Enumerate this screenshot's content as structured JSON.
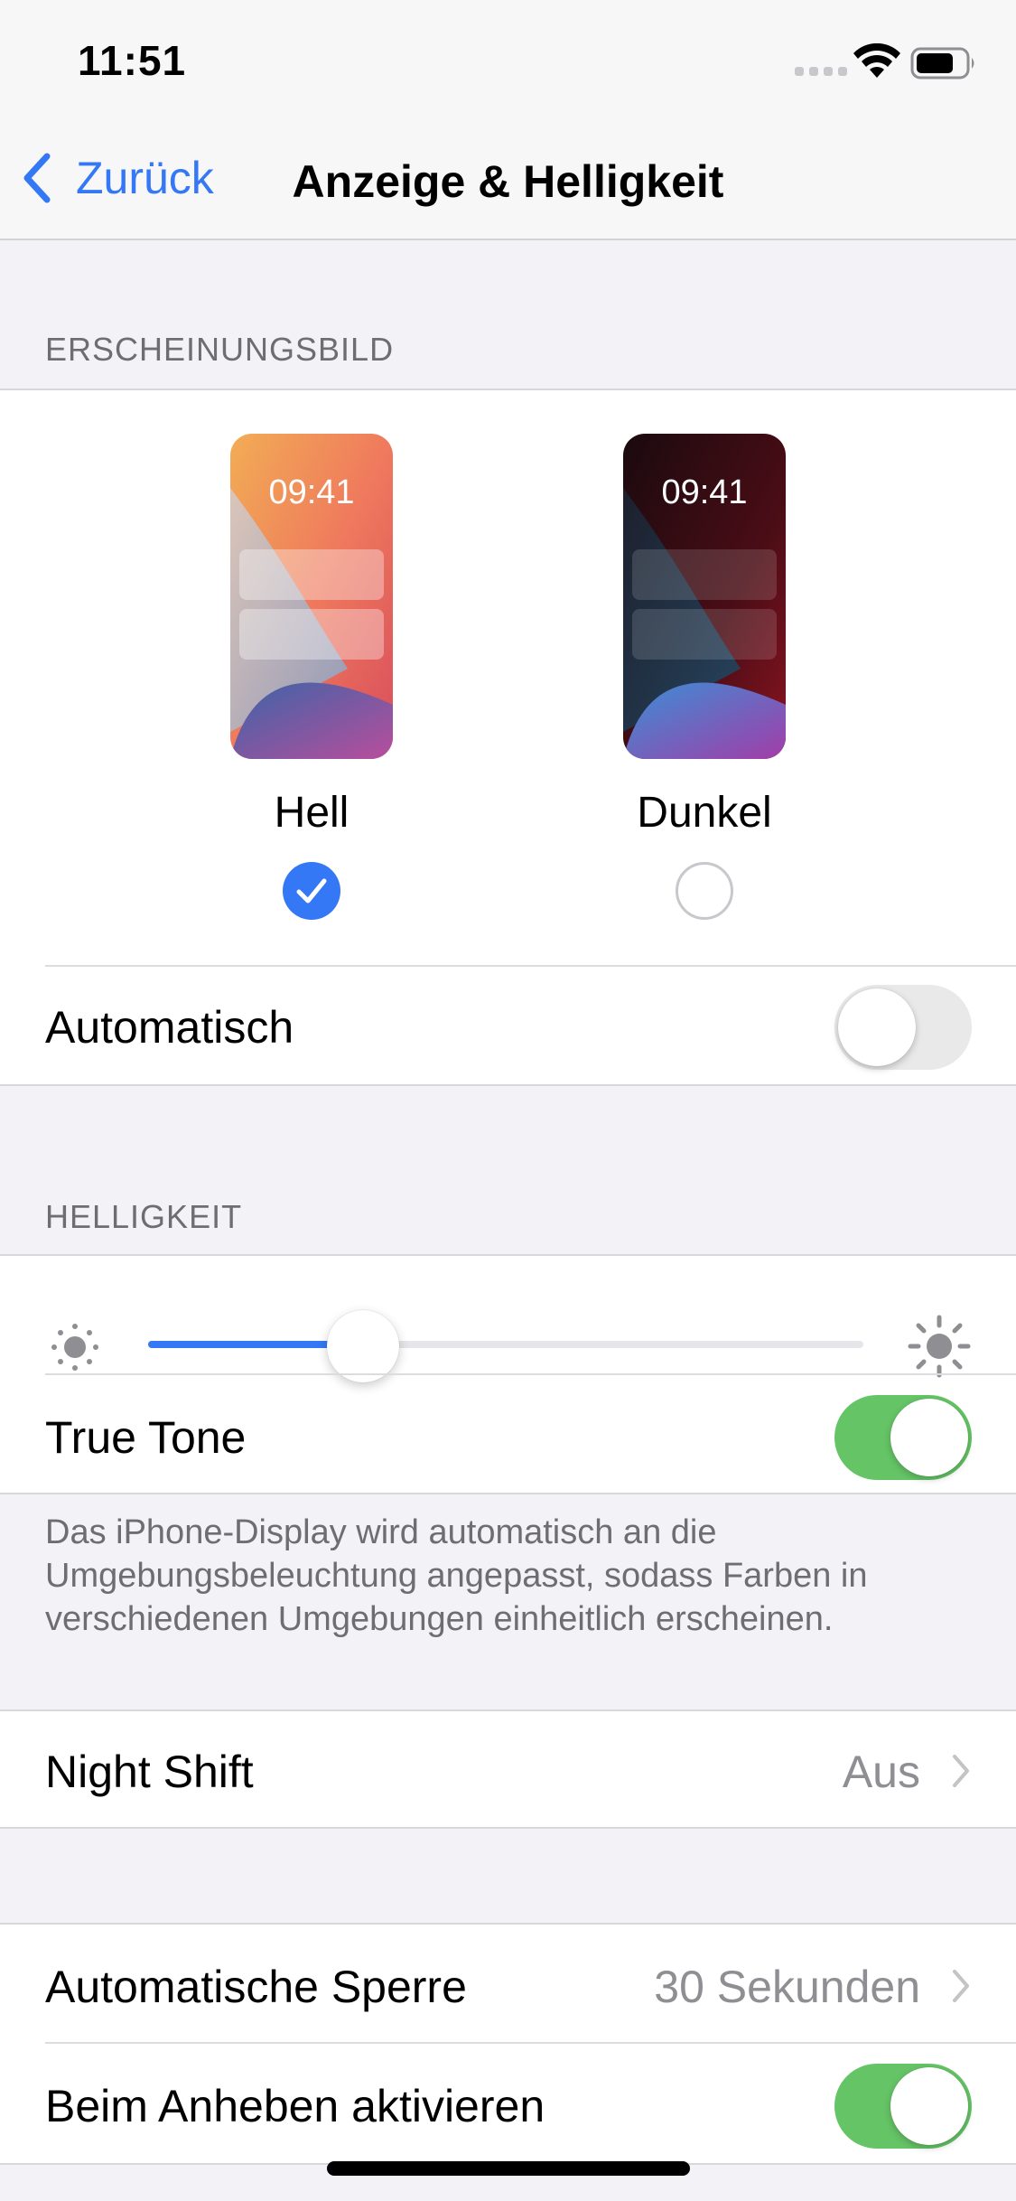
{
  "status_bar": {
    "time": "11:51"
  },
  "nav": {
    "back_label": "Zurück",
    "title": "Anzeige & Helligkeit"
  },
  "appearance": {
    "header": "ERSCHEINUNGSBILD",
    "options": [
      {
        "label": "Hell",
        "preview_time": "09:41",
        "selected": true
      },
      {
        "label": "Dunkel",
        "preview_time": "09:41",
        "selected": false
      }
    ],
    "automatic_label": "Automatisch",
    "automatic_on": false
  },
  "brightness": {
    "header": "HELLIGKEIT",
    "level_percent": 30,
    "true_tone_label": "True Tone",
    "true_tone_on": true,
    "footer": "Das iPhone-Display wird automatisch an die Umgebungsbeleuchtung angepasst, sodass Farben in verschiedenen Umgebungen einheitlich erscheinen."
  },
  "night_shift": {
    "label": "Night Shift",
    "value": "Aus"
  },
  "lock": {
    "auto_lock_label": "Automatische Sperre",
    "auto_lock_value": "30 Sekunden",
    "raise_to_wake_label": "Beim Anheben aktivieren",
    "raise_to_wake_on": true
  },
  "colors": {
    "accent": "#3478f6",
    "toggle_on": "#65c466",
    "toggle_off": "#e9e9ea",
    "background": "#f2f2f7"
  }
}
